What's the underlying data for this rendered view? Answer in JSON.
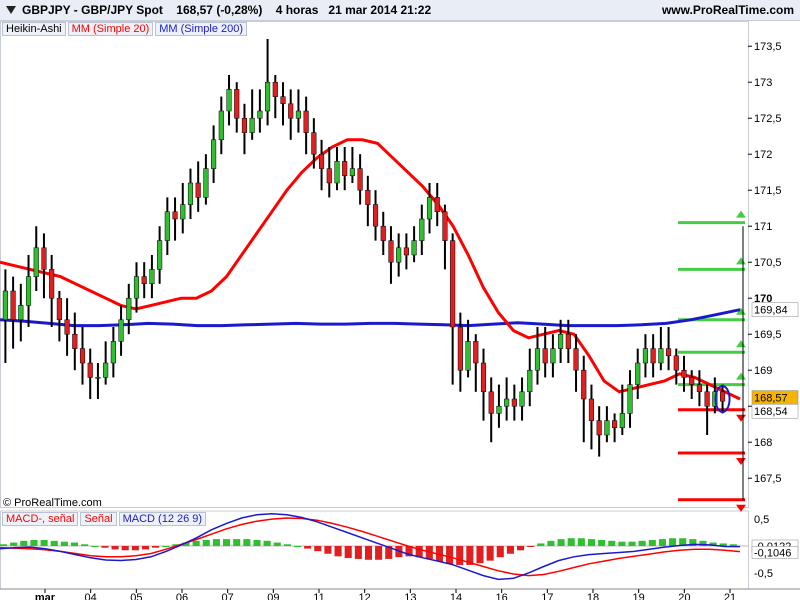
{
  "header": {
    "title": "GBPJPY - GBP/JPY Spot",
    "last": "168,57 (-0,28%)",
    "period": "4 horas",
    "datetime": "21 mar 2014 21:22",
    "site": "www.ProRealTime.com"
  },
  "legend": {
    "type": "Heikin-Ashi",
    "ma20": "MM (Simple 20)",
    "ma200": "MM (Simple 200)"
  },
  "copyright": "© ProRealTime.com",
  "macd_legend": {
    "macd_signal": "MACD-, señal",
    "signal": "Señal",
    "macd": "MACD (12 26 9)"
  },
  "colors": {
    "up": "#2fbf2f",
    "down": "#e02020",
    "ma20": "#ff0000",
    "ma200": "#1a1acc",
    "support": "#ff0000",
    "resistance": "#44cc44"
  },
  "chart_data": [
    {
      "type": "candlestick",
      "ylim": [
        167.1,
        173.85
      ],
      "yticks": [
        "173,5",
        "173",
        "172,5",
        "172",
        "171,5",
        "171",
        "170,5",
        "170",
        "169,5",
        "169",
        "168,5",
        "168",
        "167,5"
      ],
      "xticks": [
        "mar",
        "04",
        "05",
        "06",
        "07",
        "09",
        "11",
        "12",
        "13",
        "14",
        "16",
        "17",
        "18",
        "19",
        "20",
        "21"
      ],
      "price_labels": {
        "ma200": "169,84",
        "last": "168,57",
        "ma20": "168,54"
      },
      "candles": [
        {
          "o": 169.7,
          "c": 170.1,
          "h": 170.4,
          "l": 169.1
        },
        {
          "o": 170.1,
          "c": 169.7,
          "h": 170.3,
          "l": 169.3
        },
        {
          "o": 169.7,
          "c": 169.9,
          "h": 170.2,
          "l": 169.4
        },
        {
          "o": 169.9,
          "c": 170.3,
          "h": 170.6,
          "l": 169.6
        },
        {
          "o": 170.3,
          "c": 170.7,
          "h": 171.0,
          "l": 170.1
        },
        {
          "o": 170.7,
          "c": 170.4,
          "h": 170.9,
          "l": 170.0
        },
        {
          "o": 170.4,
          "c": 170.0,
          "h": 170.6,
          "l": 169.6
        },
        {
          "o": 170.0,
          "c": 169.7,
          "h": 170.1,
          "l": 169.4
        },
        {
          "o": 169.7,
          "c": 169.5,
          "h": 170.0,
          "l": 169.2
        },
        {
          "o": 169.5,
          "c": 169.3,
          "h": 169.8,
          "l": 169.0
        },
        {
          "o": 169.3,
          "c": 169.1,
          "h": 169.6,
          "l": 168.8
        },
        {
          "o": 169.1,
          "c": 168.9,
          "h": 169.3,
          "l": 168.6
        },
        {
          "o": 168.9,
          "c": 168.9,
          "h": 169.1,
          "l": 168.6
        },
        {
          "o": 168.9,
          "c": 169.1,
          "h": 169.4,
          "l": 168.8
        },
        {
          "o": 169.1,
          "c": 169.4,
          "h": 169.6,
          "l": 168.9
        },
        {
          "o": 169.4,
          "c": 169.7,
          "h": 169.9,
          "l": 169.2
        },
        {
          "o": 169.7,
          "c": 170.0,
          "h": 170.2,
          "l": 169.5
        },
        {
          "o": 170.0,
          "c": 170.3,
          "h": 170.5,
          "l": 169.8
        },
        {
          "o": 170.3,
          "c": 170.2,
          "h": 170.5,
          "l": 170.0
        },
        {
          "o": 170.2,
          "c": 170.4,
          "h": 170.6,
          "l": 170.0
        },
        {
          "o": 170.4,
          "c": 170.8,
          "h": 171.0,
          "l": 170.2
        },
        {
          "o": 170.8,
          "c": 171.2,
          "h": 171.4,
          "l": 170.6
        },
        {
          "o": 171.2,
          "c": 171.1,
          "h": 171.4,
          "l": 170.8
        },
        {
          "o": 171.1,
          "c": 171.3,
          "h": 171.6,
          "l": 170.9
        },
        {
          "o": 171.3,
          "c": 171.6,
          "h": 171.8,
          "l": 171.1
        },
        {
          "o": 171.6,
          "c": 171.4,
          "h": 171.9,
          "l": 171.2
        },
        {
          "o": 171.4,
          "c": 171.8,
          "h": 172.0,
          "l": 171.3
        },
        {
          "o": 171.8,
          "c": 172.2,
          "h": 172.4,
          "l": 171.6
        },
        {
          "o": 172.2,
          "c": 172.6,
          "h": 172.8,
          "l": 172.0
        },
        {
          "o": 172.6,
          "c": 172.9,
          "h": 173.1,
          "l": 172.4
        },
        {
          "o": 172.9,
          "c": 172.5,
          "h": 173.0,
          "l": 172.3
        },
        {
          "o": 172.5,
          "c": 172.3,
          "h": 172.7,
          "l": 172.0
        },
        {
          "o": 172.3,
          "c": 172.5,
          "h": 172.9,
          "l": 172.2
        },
        {
          "o": 172.5,
          "c": 172.6,
          "h": 172.9,
          "l": 172.3
        },
        {
          "o": 172.6,
          "c": 173.0,
          "h": 173.6,
          "l": 172.4
        },
        {
          "o": 173.0,
          "c": 172.8,
          "h": 173.1,
          "l": 172.5
        },
        {
          "o": 172.8,
          "c": 172.7,
          "h": 173.0,
          "l": 172.4
        },
        {
          "o": 172.7,
          "c": 172.5,
          "h": 172.9,
          "l": 172.2
        },
        {
          "o": 172.5,
          "c": 172.6,
          "h": 172.9,
          "l": 172.3
        },
        {
          "o": 172.6,
          "c": 172.3,
          "h": 172.8,
          "l": 172.0
        },
        {
          "o": 172.3,
          "c": 172.0,
          "h": 172.5,
          "l": 171.8
        },
        {
          "o": 172.0,
          "c": 171.8,
          "h": 172.2,
          "l": 171.5
        },
        {
          "o": 171.8,
          "c": 171.6,
          "h": 172.1,
          "l": 171.4
        },
        {
          "o": 171.6,
          "c": 171.9,
          "h": 172.1,
          "l": 171.5
        },
        {
          "o": 171.9,
          "c": 171.7,
          "h": 172.1,
          "l": 171.5
        },
        {
          "o": 171.7,
          "c": 171.8,
          "h": 172.1,
          "l": 171.6
        },
        {
          "o": 171.8,
          "c": 171.5,
          "h": 172.0,
          "l": 171.3
        },
        {
          "o": 171.5,
          "c": 171.3,
          "h": 171.7,
          "l": 171.0
        },
        {
          "o": 171.3,
          "c": 171.0,
          "h": 171.5,
          "l": 170.8
        },
        {
          "o": 171.0,
          "c": 170.8,
          "h": 171.2,
          "l": 170.6
        },
        {
          "o": 170.8,
          "c": 170.5,
          "h": 171.0,
          "l": 170.2
        },
        {
          "o": 170.5,
          "c": 170.7,
          "h": 170.9,
          "l": 170.3
        },
        {
          "o": 170.7,
          "c": 170.6,
          "h": 170.9,
          "l": 170.4
        },
        {
          "o": 170.6,
          "c": 170.8,
          "h": 171.0,
          "l": 170.5
        },
        {
          "o": 170.8,
          "c": 171.1,
          "h": 171.3,
          "l": 170.6
        },
        {
          "o": 171.1,
          "c": 171.4,
          "h": 171.6,
          "l": 170.9
        },
        {
          "o": 171.4,
          "c": 171.2,
          "h": 171.6,
          "l": 171.0
        },
        {
          "o": 171.2,
          "c": 170.8,
          "h": 171.3,
          "l": 170.4
        },
        {
          "o": 170.8,
          "c": 169.6,
          "h": 170.9,
          "l": 168.8
        },
        {
          "o": 169.6,
          "c": 169.0,
          "h": 169.8,
          "l": 168.7
        },
        {
          "o": 169.0,
          "c": 169.4,
          "h": 169.7,
          "l": 168.9
        },
        {
          "o": 169.4,
          "c": 169.1,
          "h": 169.5,
          "l": 168.7
        },
        {
          "o": 169.1,
          "c": 168.7,
          "h": 169.3,
          "l": 168.3
        },
        {
          "o": 168.7,
          "c": 168.4,
          "h": 168.9,
          "l": 168.0
        },
        {
          "o": 168.4,
          "c": 168.5,
          "h": 168.8,
          "l": 168.2
        },
        {
          "o": 168.5,
          "c": 168.6,
          "h": 168.9,
          "l": 168.3
        },
        {
          "o": 168.6,
          "c": 168.5,
          "h": 168.8,
          "l": 168.3
        },
        {
          "o": 168.5,
          "c": 168.7,
          "h": 168.9,
          "l": 168.3
        },
        {
          "o": 168.7,
          "c": 169.0,
          "h": 169.3,
          "l": 168.5
        },
        {
          "o": 169.0,
          "c": 169.3,
          "h": 169.6,
          "l": 168.8
        },
        {
          "o": 169.3,
          "c": 169.1,
          "h": 169.6,
          "l": 168.9
        },
        {
          "o": 169.1,
          "c": 169.3,
          "h": 169.5,
          "l": 168.9
        },
        {
          "o": 169.3,
          "c": 169.5,
          "h": 169.7,
          "l": 169.1
        },
        {
          "o": 169.5,
          "c": 169.3,
          "h": 169.7,
          "l": 169.1
        },
        {
          "o": 169.3,
          "c": 169.0,
          "h": 169.5,
          "l": 168.7
        },
        {
          "o": 169.0,
          "c": 168.6,
          "h": 169.2,
          "l": 168.0
        },
        {
          "o": 168.6,
          "c": 168.3,
          "h": 168.8,
          "l": 167.9
        },
        {
          "o": 168.3,
          "c": 168.1,
          "h": 168.5,
          "l": 167.8
        },
        {
          "o": 168.1,
          "c": 168.3,
          "h": 168.5,
          "l": 168.0
        },
        {
          "o": 168.3,
          "c": 168.2,
          "h": 168.4,
          "l": 168.0
        },
        {
          "o": 168.2,
          "c": 168.4,
          "h": 168.8,
          "l": 168.1
        },
        {
          "o": 168.4,
          "c": 168.8,
          "h": 169.0,
          "l": 168.2
        },
        {
          "o": 168.8,
          "c": 169.1,
          "h": 169.3,
          "l": 168.6
        },
        {
          "o": 169.1,
          "c": 169.3,
          "h": 169.5,
          "l": 168.9
        },
        {
          "o": 169.3,
          "c": 169.1,
          "h": 169.5,
          "l": 168.9
        },
        {
          "o": 169.1,
          "c": 169.3,
          "h": 169.6,
          "l": 169.0
        },
        {
          "o": 169.3,
          "c": 169.2,
          "h": 169.6,
          "l": 169.0
        },
        {
          "o": 169.2,
          "c": 169.0,
          "h": 169.3,
          "l": 168.8
        },
        {
          "o": 169.0,
          "c": 168.9,
          "h": 169.2,
          "l": 168.7
        },
        {
          "o": 168.9,
          "c": 168.8,
          "h": 169.0,
          "l": 168.6
        },
        {
          "o": 168.8,
          "c": 168.7,
          "h": 169.0,
          "l": 168.5
        },
        {
          "o": 168.7,
          "c": 168.5,
          "h": 168.8,
          "l": 168.1
        },
        {
          "o": 168.5,
          "c": 168.7,
          "h": 168.9,
          "l": 168.4
        },
        {
          "o": 168.7,
          "c": 168.57,
          "h": 168.8,
          "l": 168.4
        }
      ],
      "ma20": [
        170.5,
        170.45,
        170.4,
        170.35,
        170.3,
        170.2,
        170.1,
        170.0,
        169.9,
        169.85,
        169.9,
        169.95,
        170.0,
        170.0,
        170.1,
        170.3,
        170.6,
        170.9,
        171.2,
        171.5,
        171.75,
        171.95,
        172.1,
        172.2,
        172.2,
        172.15,
        171.95,
        171.75,
        171.55,
        171.3,
        171.0,
        170.6,
        170.15,
        169.8,
        169.55,
        169.45,
        169.5,
        169.55,
        169.5,
        169.2,
        168.85,
        168.7,
        168.75,
        168.8,
        168.85,
        168.95,
        168.9,
        168.8,
        168.7,
        168.6
      ],
      "ma200": [
        169.7,
        169.68,
        169.65,
        169.62,
        169.62,
        169.63,
        169.65,
        169.64,
        169.62,
        169.62,
        169.63,
        169.64,
        169.65,
        169.64,
        169.64,
        169.65,
        169.65,
        169.64,
        169.63,
        169.62,
        169.64,
        169.66,
        169.64,
        169.62,
        169.62,
        169.62,
        169.63,
        169.65,
        169.7,
        169.77,
        169.84
      ],
      "support_lines": [
        168.45,
        167.85,
        167.2
      ],
      "resistance_lines": [
        171.05,
        170.4,
        169.7,
        169.25,
        168.8
      ]
    },
    {
      "type": "bar",
      "name": "MACD (12 26 9)",
      "ylim": [
        -0.65,
        0.65
      ],
      "yticks": [
        "0,5",
        "-0,5"
      ],
      "value_labels": [
        "-0,0122",
        "-0,1046"
      ],
      "histogram": [
        0.02,
        0.04,
        0.06,
        0.07,
        0.07,
        0.06,
        0.05,
        0.04,
        0.02,
        0.0,
        -0.02,
        -0.04,
        -0.05,
        -0.05,
        -0.04,
        -0.02,
        0.0,
        0.02,
        0.04,
        0.06,
        0.07,
        0.08,
        0.08,
        0.08,
        0.08,
        0.07,
        0.06,
        0.04,
        0.02,
        0.0,
        -0.03,
        -0.06,
        -0.09,
        -0.12,
        -0.14,
        -0.15,
        -0.16,
        -0.16,
        -0.15,
        -0.13,
        -0.12,
        -0.13,
        -0.15,
        -0.18,
        -0.21,
        -0.22,
        -0.22,
        -0.2,
        -0.17,
        -0.13,
        -0.09,
        -0.05,
        -0.01,
        0.03,
        0.06,
        0.08,
        0.09,
        0.09,
        0.08,
        0.07,
        0.06,
        0.05,
        0.05,
        0.06,
        0.07,
        0.08,
        0.09,
        0.09,
        0.08,
        0.06,
        0.04,
        0.03,
        0.02
      ],
      "macd": [
        -0.05,
        -0.03,
        -0.02,
        -0.05,
        -0.1,
        -0.16,
        -0.22,
        -0.26,
        -0.27,
        -0.25,
        -0.2,
        -0.1,
        0.02,
        0.15,
        0.3,
        0.42,
        0.52,
        0.58,
        0.6,
        0.58,
        0.53,
        0.45,
        0.35,
        0.25,
        0.15,
        0.05,
        -0.05,
        -0.15,
        -0.22,
        -0.28,
        -0.35,
        -0.45,
        -0.55,
        -0.62,
        -0.6,
        -0.5,
        -0.38,
        -0.27,
        -0.2,
        -0.16,
        -0.14,
        -0.12,
        -0.1,
        -0.06,
        -0.02,
        0.01,
        0.03,
        0.02,
        -0.01,
        -0.012
      ],
      "signal": [
        -0.03,
        -0.04,
        -0.05,
        -0.07,
        -0.1,
        -0.14,
        -0.18,
        -0.2,
        -0.2,
        -0.18,
        -0.14,
        -0.06,
        0.03,
        0.12,
        0.22,
        0.32,
        0.4,
        0.46,
        0.5,
        0.52,
        0.51,
        0.48,
        0.42,
        0.35,
        0.27,
        0.18,
        0.09,
        0.0,
        -0.08,
        -0.15,
        -0.22,
        -0.3,
        -0.38,
        -0.46,
        -0.52,
        -0.55,
        -0.53,
        -0.47,
        -0.4,
        -0.33,
        -0.28,
        -0.23,
        -0.19,
        -0.15,
        -0.11,
        -0.08,
        -0.06,
        -0.06,
        -0.08,
        -0.1046
      ]
    }
  ]
}
